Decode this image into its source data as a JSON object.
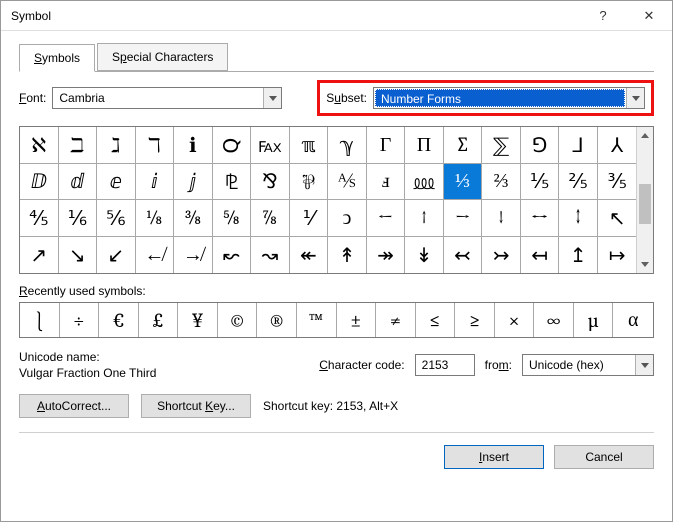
{
  "window": {
    "title": "Symbol"
  },
  "tabs": {
    "symbols": "Symbols",
    "special": "Special Characters"
  },
  "font": {
    "label": "Font:",
    "value": "Cambria"
  },
  "subset": {
    "label": "Subset:",
    "value": "Number Forms"
  },
  "grid": {
    "rows": [
      [
        "ℵ",
        "ℶ",
        "ℷ",
        "ℸ",
        "ℹ",
        "℺",
        "℻",
        "ℼ",
        "ℽ",
        "Γ",
        "Π",
        "∑",
        "⅀",
        "⅁",
        "⅃",
        "⅄"
      ],
      [
        "ⅅ",
        "ⅆ",
        "ⅇ",
        "ⅈ",
        "ⅉ",
        "⅊",
        "⅋",
        "⅌",
        "⅍",
        "ⅎ",
        "⅏",
        "⅓",
        "⅔",
        "⅕",
        "⅖",
        "⅗"
      ],
      [
        "⅘",
        "⅙",
        "⅚",
        "⅛",
        "⅜",
        "⅝",
        "⅞",
        "⅟",
        "ↄ",
        "←",
        "↑",
        "→",
        "↓",
        "↔",
        "↕",
        "↖"
      ],
      [
        "↗",
        "↘",
        "↙",
        "↚",
        "↛",
        "↜",
        "↝",
        "↞",
        "↟",
        "↠",
        "↡",
        "↢",
        "↣",
        "↤",
        "↥",
        "↦"
      ]
    ],
    "selected": {
      "row": 1,
      "col": 11
    }
  },
  "recent": {
    "label": "Recently used symbols:",
    "items": [
      "⎱",
      "÷",
      "€",
      "£",
      "¥",
      "©",
      "®",
      "™",
      "±",
      "≠",
      "≤",
      "≥",
      "×",
      "∞",
      "µ",
      "α"
    ]
  },
  "unicode": {
    "name_label": "Unicode name:",
    "name_value": "Vulgar Fraction One Third",
    "code_label": "Character code:",
    "code_value": "2153",
    "from_label": "from:",
    "from_value": "Unicode (hex)"
  },
  "buttons": {
    "autocorrect": "AutoCorrect...",
    "shortcutkey": "Shortcut Key...",
    "shortcut_text": "Shortcut key: 2153, Alt+X",
    "insert": "Insert",
    "cancel": "Cancel"
  }
}
